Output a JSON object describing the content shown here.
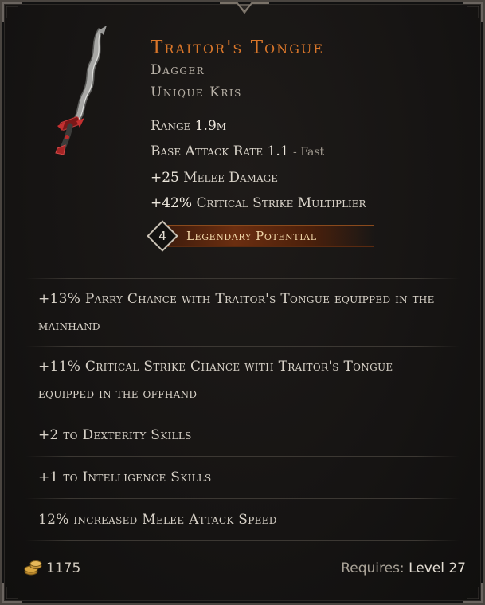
{
  "item": {
    "name": "Traitor's Tongue",
    "type": "Dagger",
    "base": "Unique Kris",
    "range_label": "Range",
    "range_value": "1.9m",
    "attack_rate_label": "Base Attack Rate",
    "attack_rate_value": "1.1",
    "attack_rate_speed": "- Fast",
    "implicits": [
      {
        "value": "+25",
        "text": "Melee Damage"
      },
      {
        "value": "+42%",
        "text": "Critical Strike Multiplier"
      }
    ],
    "legendary_potential": {
      "count": "4",
      "label": "Legendary Potential"
    },
    "icon": "curved-dagger-icon"
  },
  "affixes": [
    "+13% Parry Chance with Traitor's Tongue equipped in the mainhand",
    "+11% Critical Strike Chance with Traitor's Tongue equipped in the offhand",
    "+2 to Dexterity Skills",
    "+1 to Intelligence Skills",
    "12% increased Melee Attack Speed"
  ],
  "footer": {
    "gold_icon": "gold-coins-icon",
    "gold_value": "1175",
    "requires_label": "Requires:",
    "requires_value": "Level 27"
  },
  "colors": {
    "name": "#d9762a",
    "legendary_bar": "#6b2e10",
    "text": "#d8d2c8",
    "border": "#4a4540"
  }
}
